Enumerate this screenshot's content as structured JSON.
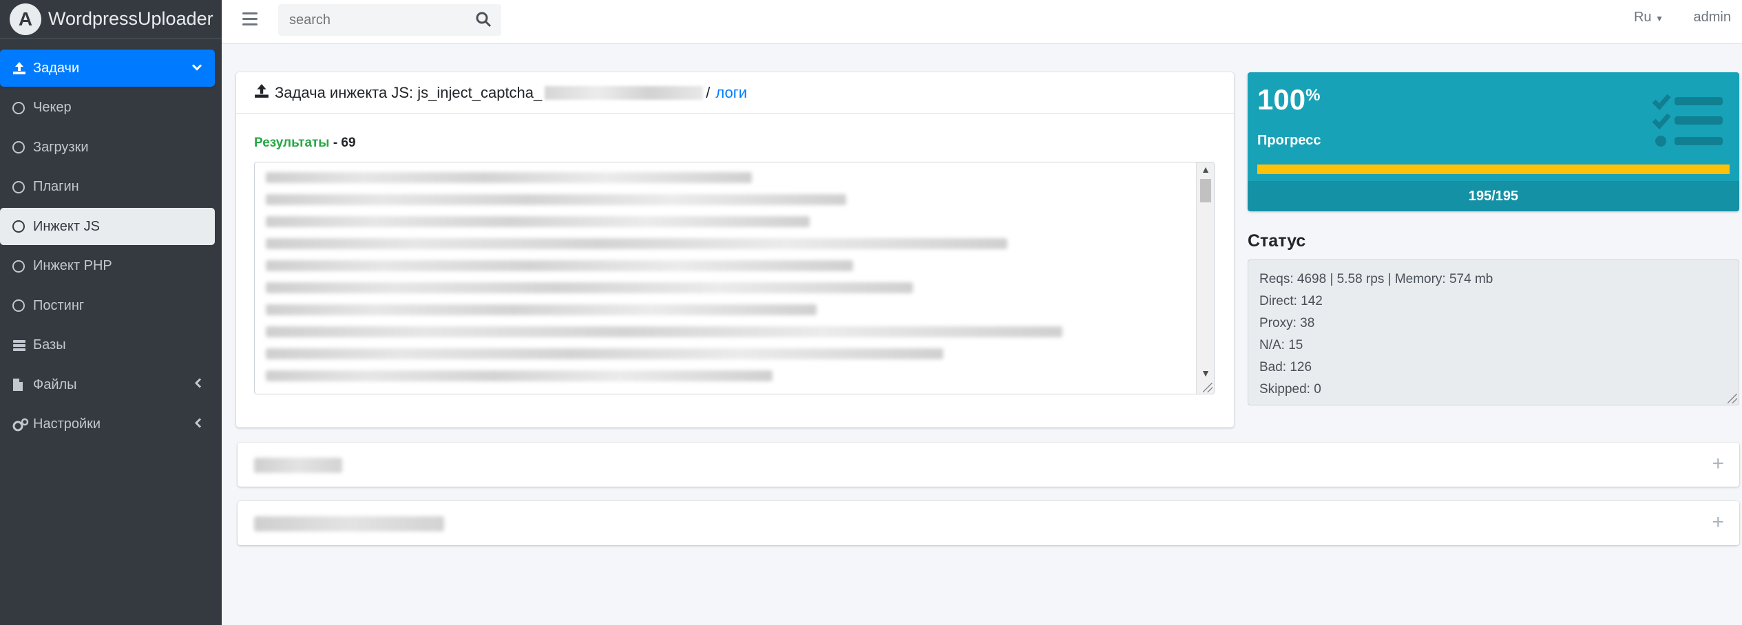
{
  "brand": {
    "name_bold": "Wordpress",
    "name_light": "Uploader",
    "logo_letter": "A"
  },
  "sidebar": {
    "items": [
      {
        "label": "Задачи",
        "icon": "upload-icon",
        "state": "active",
        "arrow": "chevron-down"
      },
      {
        "label": "Чекер",
        "icon": "circle-icon"
      },
      {
        "label": "Загрузки",
        "icon": "circle-icon"
      },
      {
        "label": "Плагин",
        "icon": "circle-icon"
      },
      {
        "label": "Инжект JS",
        "icon": "circle-icon",
        "state": "selected"
      },
      {
        "label": "Инжект PHP",
        "icon": "circle-icon"
      },
      {
        "label": "Постинг",
        "icon": "circle-icon"
      },
      {
        "label": "Базы",
        "icon": "database-icon"
      },
      {
        "label": "Файлы",
        "icon": "file-icon",
        "arrow": "chevron-left"
      },
      {
        "label": "Настройки",
        "icon": "cogs-icon",
        "arrow": "chevron-left"
      }
    ]
  },
  "topbar": {
    "search_placeholder": "search",
    "language": "Ru",
    "user": "admin"
  },
  "task": {
    "title_prefix": "Задача инжекта JS: js_inject_captcha_",
    "separator": "/",
    "logs_link": "логи",
    "results_label": "Результаты",
    "results_count": "- 69"
  },
  "progress": {
    "percent_value": "100",
    "percent_sign": "%",
    "label": "Прогресс",
    "fraction": 1.0,
    "counter": "195/195",
    "bar_color": "#ffc107",
    "card_color": "#17a2b8"
  },
  "status": {
    "title": "Статус",
    "lines": [
      "Reqs: 4698 | 5.58 rps | Memory: 574 mb",
      "Direct: 142",
      "Proxy: 38",
      "N/A: 15",
      "Bad: 126",
      "Skipped: 0"
    ]
  },
  "colors": {
    "primary": "#007bff",
    "success": "#28a745",
    "sidebar_bg": "#343a40"
  }
}
